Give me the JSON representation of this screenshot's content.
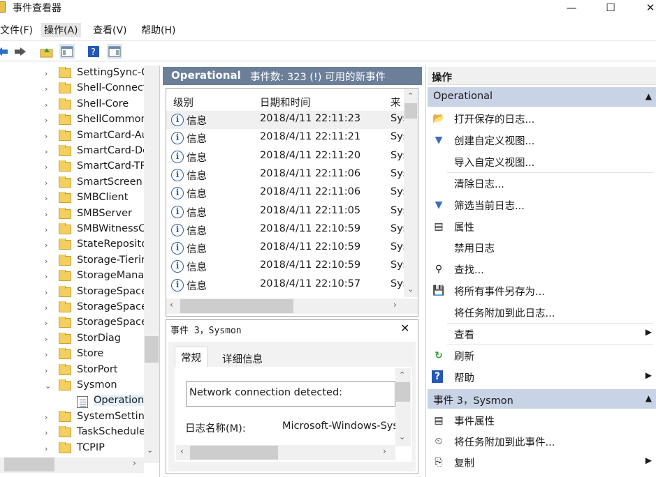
{
  "window": {
    "title": "事件查看器",
    "minimize": "—",
    "maximize": "☐",
    "close": "✕"
  },
  "menu": {
    "file": "文件(F)",
    "action": "操作(A)",
    "view": "查看(V)",
    "help": "帮助(H)"
  },
  "tree": {
    "items": [
      "SettingSync-C",
      "Shell-Connect",
      "Shell-Core",
      "ShellCommon",
      "SmartCard-Au",
      "SmartCard-De",
      "SmartCard-TP",
      "SmartScreen",
      "SMBClient",
      "SMBServer",
      "SMBWitnessC",
      "StateReposito",
      "Storage-Tierin",
      "StorageManag",
      "StorageSpace",
      "StorageSpace",
      "StorageSpace",
      "StorDiag",
      "Store",
      "StorPort",
      "Sysmon",
      "Operational",
      "SystemSetting",
      "TaskSchedule",
      "TCPIP"
    ],
    "chevrons": [
      "›",
      "›",
      "›",
      "›",
      "›",
      "›",
      "›",
      "›",
      "›",
      "›",
      "›",
      "›",
      "›",
      "›",
      "›",
      "›",
      "›",
      "›",
      "›",
      "›",
      "⌄",
      "",
      "›",
      "›",
      "›"
    ]
  },
  "events": {
    "log_name": "Operational",
    "summary": "事件数: 323 (!) 可用的新事件",
    "columns": {
      "level": "级别",
      "datetime": "日期和时间",
      "source": "来"
    },
    "rows": [
      {
        "level": "信息",
        "datetime": "2018/4/11 22:11:23",
        "source": "Sys"
      },
      {
        "level": "信息",
        "datetime": "2018/4/11 22:11:21",
        "source": "Sys"
      },
      {
        "level": "信息",
        "datetime": "2018/4/11 22:11:20",
        "source": "Sys"
      },
      {
        "level": "信息",
        "datetime": "2018/4/11 22:11:06",
        "source": "Sys"
      },
      {
        "level": "信息",
        "datetime": "2018/4/11 22:11:06",
        "source": "Sys"
      },
      {
        "level": "信息",
        "datetime": "2018/4/11 22:11:05",
        "source": "Sys"
      },
      {
        "level": "信息",
        "datetime": "2018/4/11 22:10:59",
        "source": "Sys"
      },
      {
        "level": "信息",
        "datetime": "2018/4/11 22:10:59",
        "source": "Sys"
      },
      {
        "level": "信息",
        "datetime": "2018/4/11 22:10:59",
        "source": "Sys"
      },
      {
        "level": "信息",
        "datetime": "2018/4/11 22:10:57",
        "source": "Sys"
      }
    ]
  },
  "detail": {
    "title": "事件 3，Sysmon",
    "close": "✕",
    "tab_general": "常规",
    "tab_details": "详细信息",
    "message": "Network connection detected:",
    "log_name_label": "日志名称(M):",
    "log_name_value": "Microsoft-Windows-Sys"
  },
  "actions": {
    "title": "操作",
    "section1": "Operational",
    "section1_items": [
      {
        "icon": "📂",
        "label": "打开保存的日志...",
        "arrow": ""
      },
      {
        "icon": "▼",
        "label": "创建自定义视图...",
        "arrow": ""
      },
      {
        "icon": "",
        "label": "导入自定义视图...",
        "arrow": ""
      },
      {
        "icon": "",
        "label": "清除日志...",
        "arrow": ""
      },
      {
        "icon": "▼",
        "label": "筛选当前日志...",
        "arrow": ""
      },
      {
        "icon": "▤",
        "label": "属性",
        "arrow": ""
      },
      {
        "icon": "",
        "label": "禁用日志",
        "arrow": ""
      },
      {
        "icon": "⚲",
        "label": "查找...",
        "arrow": ""
      },
      {
        "icon": "💾",
        "label": "将所有事件另存为...",
        "arrow": ""
      },
      {
        "icon": "",
        "label": "将任务附加到此日志...",
        "arrow": ""
      },
      {
        "icon": "",
        "label": "查看",
        "arrow": "▶"
      },
      {
        "icon": "↻",
        "label": "刷新",
        "arrow": ""
      },
      {
        "icon": "?",
        "label": "帮助",
        "arrow": "▶"
      }
    ],
    "section2": "事件 3，Sysmon",
    "section2_items": [
      {
        "icon": "▤",
        "label": "事件属性",
        "arrow": ""
      },
      {
        "icon": "⏲",
        "label": "将任务附加到此事件...",
        "arrow": ""
      },
      {
        "icon": "⎘",
        "label": "复制",
        "arrow": "▶"
      }
    ]
  }
}
